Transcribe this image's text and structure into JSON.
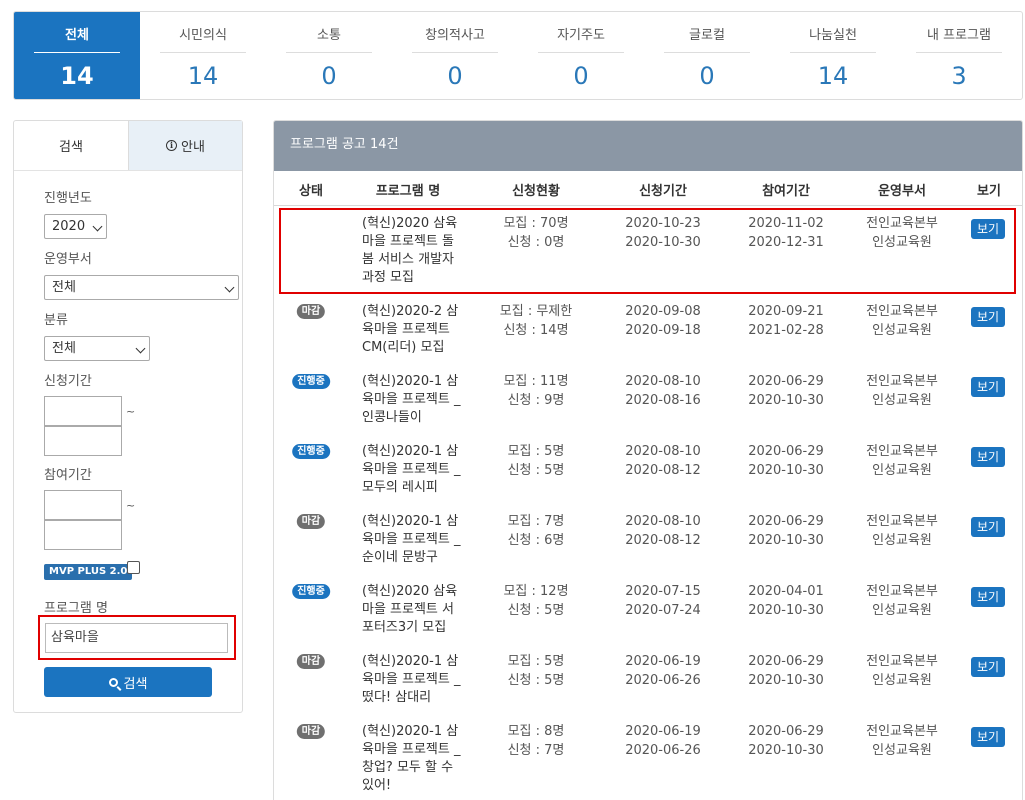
{
  "categories": [
    {
      "label": "전체",
      "count": "14"
    },
    {
      "label": "시민의식",
      "count": "14"
    },
    {
      "label": "소통",
      "count": "0"
    },
    {
      "label": "창의적사고",
      "count": "0"
    },
    {
      "label": "자기주도",
      "count": "0"
    },
    {
      "label": "글로컬",
      "count": "0"
    },
    {
      "label": "나눔실천",
      "count": "14"
    },
    {
      "label": "내 프로그램",
      "count": "3"
    }
  ],
  "sidebar": {
    "tab_search": "검색",
    "tab_info": "안내",
    "year_label": "진행년도",
    "year_value": "2020",
    "dept_label": "운영부서",
    "dept_value": "전체",
    "category_label": "분류",
    "category_value": "전체",
    "apply_period_label": "신청기간",
    "participate_period_label": "참여기간",
    "tilde": "~",
    "mvp_badge": "MVP PLUS 2.0",
    "program_name_label": "프로그램 명",
    "program_name_value": "삼육마을",
    "search_button": "검색"
  },
  "list": {
    "header_title": "프로그램 공고 14건",
    "columns": {
      "status": "상태",
      "name": "프로그램 명",
      "apply_status": "신청현황",
      "apply_period": "신청기간",
      "participate_period": "참여기간",
      "dept": "운영부서",
      "view": "보기"
    },
    "rows": [
      {
        "status": "",
        "name": "(혁신)2020 삼육마을 프로젝트 돌봄 서비스 개발자 과정 모집",
        "recruit": "모집 : 70명",
        "applied": "신청 : 0명",
        "apply_start": "2020-10-23",
        "apply_end": "2020-10-30",
        "part_start": "2020-11-02",
        "part_end": "2020-12-31",
        "dept1": "전인교육본부",
        "dept2": "인성교육원",
        "view": "보기"
      },
      {
        "status": "마감",
        "name": "(혁신)2020-2 삼육마을 프로젝트 CM(리더) 모집",
        "recruit": "모집 : 무제한",
        "applied": "신청 : 14명",
        "apply_start": "2020-09-08",
        "apply_end": "2020-09-18",
        "part_start": "2020-09-21",
        "part_end": "2021-02-28",
        "dept1": "전인교육본부",
        "dept2": "인성교육원",
        "view": "보기"
      },
      {
        "status": "진행중",
        "name": "(혁신)2020-1 삼육마을 프로젝트 _인콩나들이",
        "recruit": "모집 : 11명",
        "applied": "신청 : 9명",
        "apply_start": "2020-08-10",
        "apply_end": "2020-08-16",
        "part_start": "2020-06-29",
        "part_end": "2020-10-30",
        "dept1": "전인교육본부",
        "dept2": "인성교육원",
        "view": "보기"
      },
      {
        "status": "진행중",
        "name": "(혁신)2020-1 삼육마을 프로젝트 _모두의 레시피",
        "recruit": "모집 : 5명",
        "applied": "신청 : 5명",
        "apply_start": "2020-08-10",
        "apply_end": "2020-08-12",
        "part_start": "2020-06-29",
        "part_end": "2020-10-30",
        "dept1": "전인교육본부",
        "dept2": "인성교육원",
        "view": "보기"
      },
      {
        "status": "마감",
        "name": "(혁신)2020-1 삼육마을 프로젝트 _순이네 문방구",
        "recruit": "모집 : 7명",
        "applied": "신청 : 6명",
        "apply_start": "2020-08-10",
        "apply_end": "2020-08-12",
        "part_start": "2020-06-29",
        "part_end": "2020-10-30",
        "dept1": "전인교육본부",
        "dept2": "인성교육원",
        "view": "보기"
      },
      {
        "status": "진행중",
        "name": "(혁신)2020 삼육마을 프로젝트 서포터즈3기 모집",
        "recruit": "모집 : 12명",
        "applied": "신청 : 5명",
        "apply_start": "2020-07-15",
        "apply_end": "2020-07-24",
        "part_start": "2020-04-01",
        "part_end": "2020-10-30",
        "dept1": "전인교육본부",
        "dept2": "인성교육원",
        "view": "보기"
      },
      {
        "status": "마감",
        "name": "(혁신)2020-1 삼육마을 프로젝트 _떴다! 삼대리",
        "recruit": "모집 : 5명",
        "applied": "신청 : 5명",
        "apply_start": "2020-06-19",
        "apply_end": "2020-06-26",
        "part_start": "2020-06-29",
        "part_end": "2020-10-30",
        "dept1": "전인교육본부",
        "dept2": "인성교육원",
        "view": "보기"
      },
      {
        "status": "마감",
        "name": "(혁신)2020-1 삼육마을 프로젝트 _창업? 모두 할 수 있어!",
        "recruit": "모집 : 8명",
        "applied": "신청 : 7명",
        "apply_start": "2020-06-19",
        "apply_end": "2020-06-26",
        "part_start": "2020-06-29",
        "part_end": "2020-10-30",
        "dept1": "전인교육본부",
        "dept2": "인성교육원",
        "view": "보기"
      }
    ]
  },
  "colors": {
    "accent": "#1b74c0",
    "header_gray": "#8b97a5",
    "badge_closed": "#6f6f6f",
    "highlight": "#e00000"
  }
}
